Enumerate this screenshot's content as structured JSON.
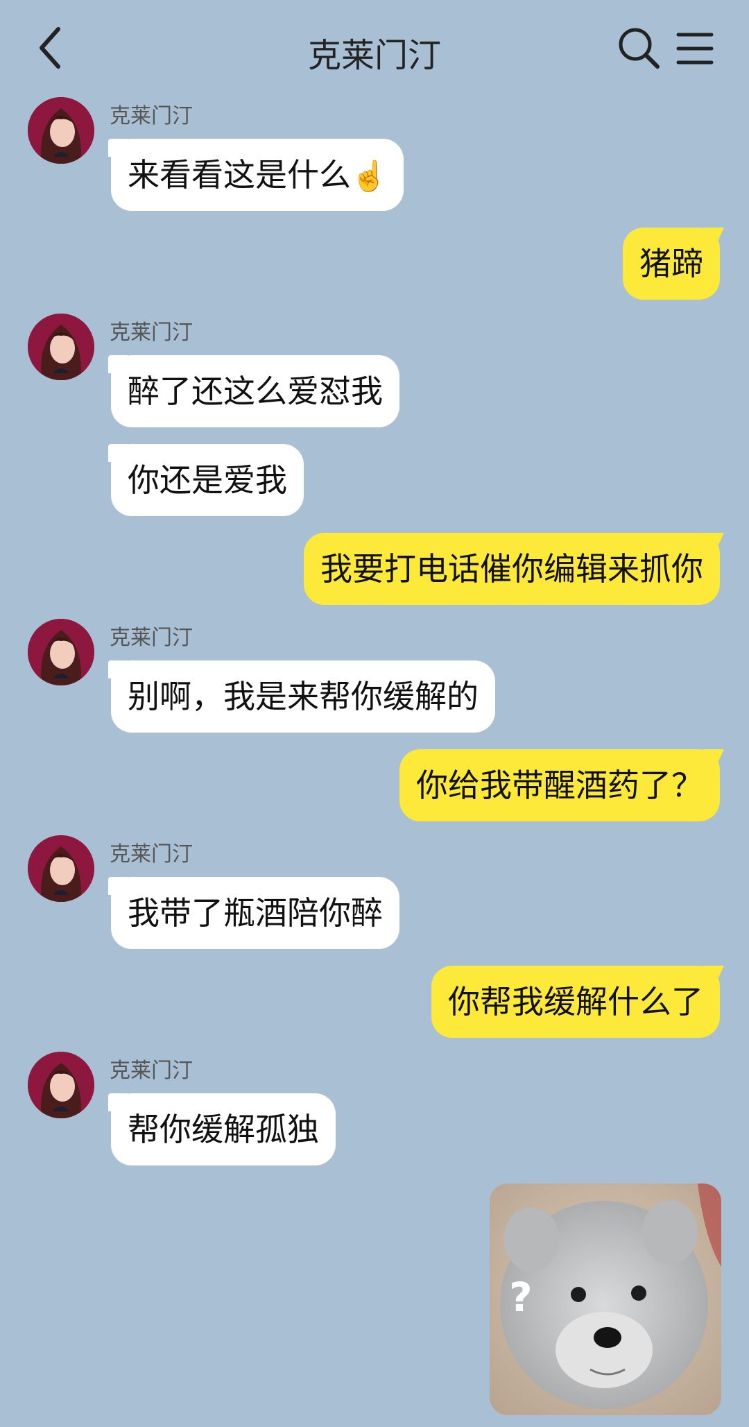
{
  "header": {
    "title": "克莱门汀"
  },
  "messages": [
    {
      "sender": "克莱门汀",
      "text": "来看看这是什么",
      "emoji": "☝️"
    },
    {
      "text": "猪蹄"
    },
    {
      "sender": "克莱门汀",
      "text": "醉了还这么爱怼我"
    },
    {
      "text": "你还是爱我"
    },
    {
      "text": "我要打电话催你编辑来抓你"
    },
    {
      "sender": "克莱门汀",
      "text": "别啊，我是来帮你缓解的"
    },
    {
      "text": "你给我带醒酒药了？"
    },
    {
      "sender": "克莱门汀",
      "text": "我带了瓶酒陪你醉"
    },
    {
      "text": "你帮我缓解什么了"
    },
    {
      "sender": "克莱门汀",
      "text": "帮你缓解孤独"
    }
  ],
  "sticker": {
    "mark": "?"
  }
}
